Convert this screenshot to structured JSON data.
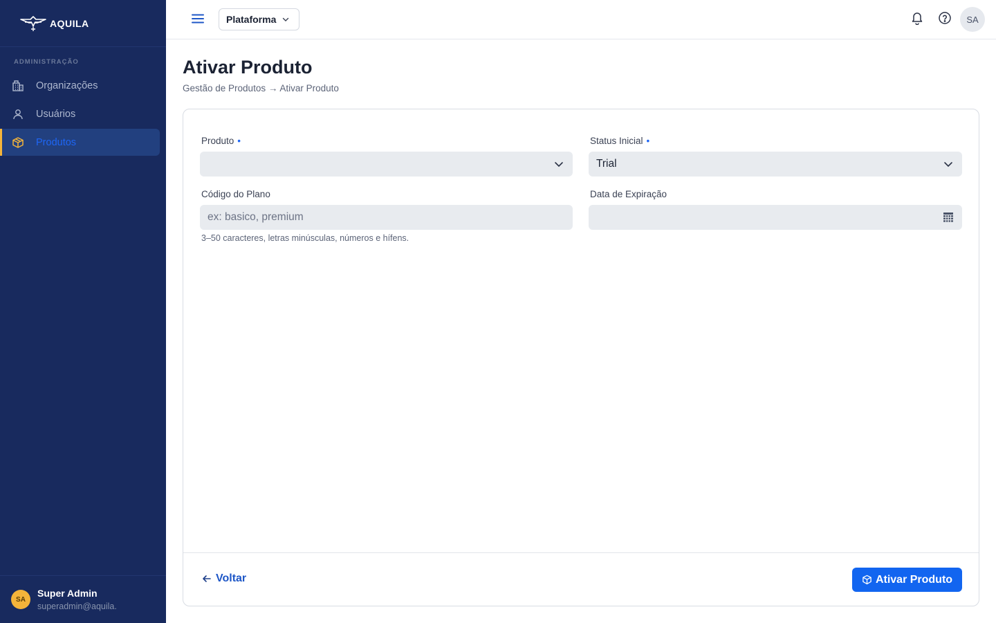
{
  "brand": {
    "name": "AQUILA"
  },
  "sidebar": {
    "section_label": "ADMINISTRAÇÃO",
    "items": [
      {
        "label": "Organizações",
        "icon": "building-icon",
        "active": false
      },
      {
        "label": "Usuários",
        "icon": "user-icon",
        "active": false
      },
      {
        "label": "Produtos",
        "icon": "package-icon",
        "active": true
      }
    ],
    "user": {
      "initials": "SA",
      "name": "Super Admin",
      "email": "superadmin@aquila."
    }
  },
  "topbar": {
    "workspace": "Plataforma",
    "avatar_initials": "SA"
  },
  "page": {
    "title": "Ativar Produto",
    "breadcrumb": "Gestão de Produtos → Ativar Produto"
  },
  "form": {
    "produto": {
      "label": "Produto",
      "required_mark": "•",
      "value": ""
    },
    "status": {
      "label": "Status Inicial",
      "required_mark": "•",
      "value": "Trial"
    },
    "codigo": {
      "label": "Código do Plano",
      "placeholder": "ex: basico, premium",
      "hint": "3–50 caracteres, letras minúsculas, números e hífens."
    },
    "data": {
      "label": "Data de Expiração",
      "value": ""
    }
  },
  "actions": {
    "back_label": "Voltar",
    "submit_label": "Ativar Produto"
  },
  "colors": {
    "sidebar_bg": "#182a5e",
    "accent": "#1265f0",
    "active_marker": "#f4b43a"
  }
}
